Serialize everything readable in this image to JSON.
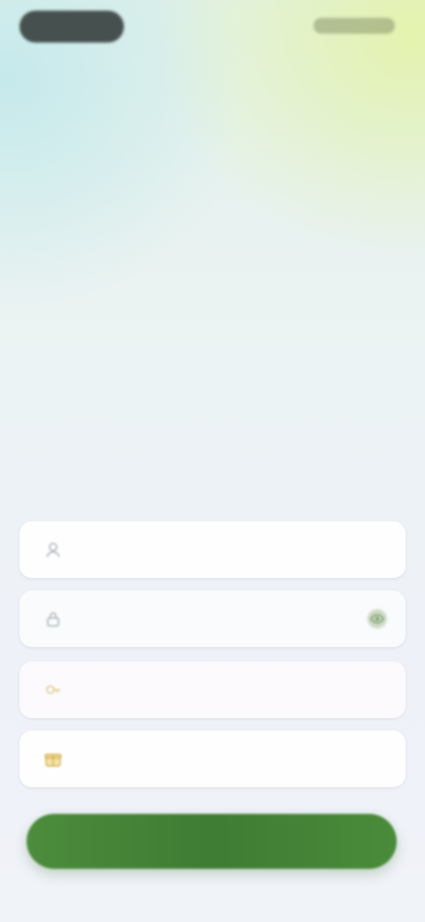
{
  "status_bar": {
    "left_pill": "",
    "right_indicators": ""
  },
  "header": {
    "headline": ""
  },
  "form": {
    "fields": [
      {
        "placeholder": "",
        "icon": "user-icon"
      },
      {
        "placeholder": "",
        "icon": "lock-icon",
        "toggle_icon": "eye-icon"
      },
      {
        "placeholder": "",
        "icon": "key-icon"
      },
      {
        "placeholder": "",
        "icon": "gift-icon"
      }
    ]
  },
  "submit": {
    "label": ""
  },
  "colors": {
    "accent": "#3f7c34",
    "accent_light": "#cfe6c6",
    "text_muted": "#55636a",
    "icon_green": "#7a9a6a",
    "icon_gold": "#d4b55a"
  }
}
